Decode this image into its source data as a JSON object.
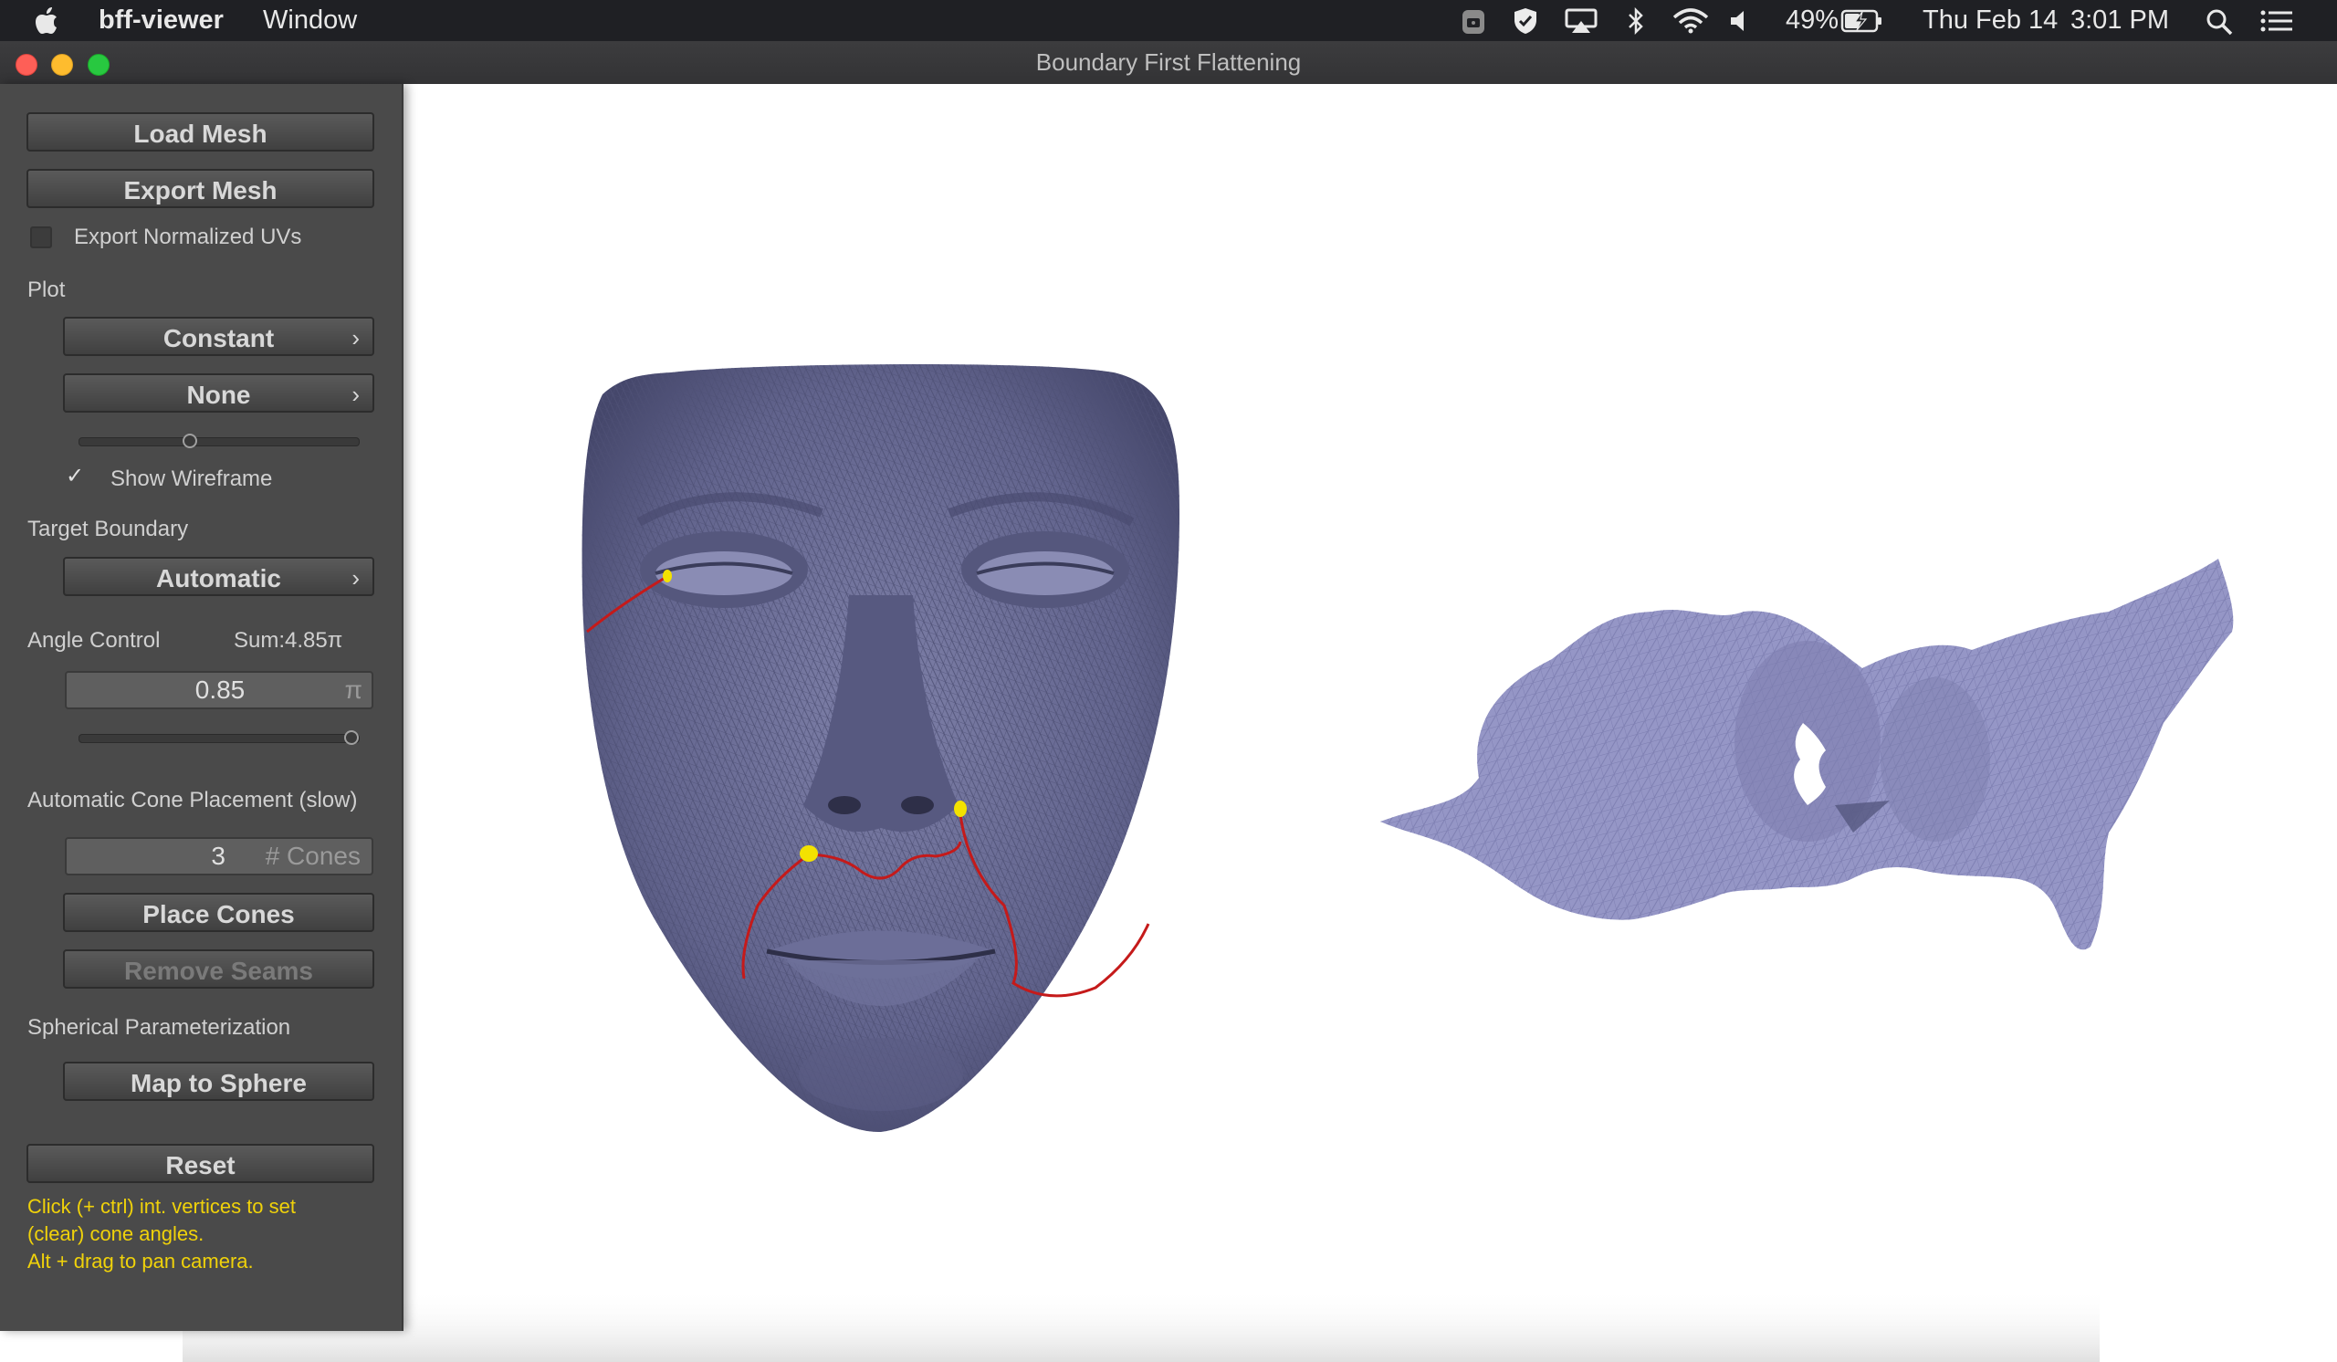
{
  "menubar": {
    "app_name": "bff-viewer",
    "menu_window": "Window",
    "battery_percent": "49%",
    "date": "Thu Feb 14",
    "time": "3:01 PM"
  },
  "window": {
    "title": "Boundary First Flattening"
  },
  "panel": {
    "load_mesh": "Load Mesh",
    "export_mesh": "Export Mesh",
    "export_normalized_uvs": {
      "label": "Export Normalized UVs",
      "checked": false
    },
    "plot": {
      "heading": "Plot",
      "color_mode": "Constant",
      "pattern": "None",
      "pattern_scale_fraction": 0.4
    },
    "show_wireframe": {
      "label": "Show Wireframe",
      "checked": true,
      "check_glyph": "✓"
    },
    "target_boundary": {
      "heading": "Target Boundary",
      "mode": "Automatic"
    },
    "angle_control": {
      "heading": "Angle Control",
      "sum": "Sum:4.85π",
      "value": "0.85",
      "unit": "π",
      "slider_fraction": 0.98
    },
    "cone_placement": {
      "heading": "Automatic Cone Placement (slow)",
      "count": "3",
      "count_placeholder": "# Cones",
      "place_cones": "Place Cones",
      "remove_seams": "Remove Seams"
    },
    "spherical": {
      "heading": "Spherical Parameterization",
      "map_to_sphere": "Map to Sphere"
    },
    "reset": "Reset",
    "hint": {
      "line1": "Click (+ ctrl) int. vertices to set",
      "line2": "(clear) cone angles.",
      "line3": "Alt + drag to pan camera."
    }
  },
  "colors": {
    "mesh": "#6a6c94",
    "flattened_mesh": "#9596c6",
    "seam": "#c51a1a",
    "cone": "#f3e200",
    "hint_text": "#f0d20a"
  },
  "icons": [
    "apple-icon",
    "vpn-icon",
    "shield-icon",
    "airplay-icon",
    "bluetooth-icon",
    "wifi-icon",
    "volume-icon",
    "battery-icon",
    "search-icon",
    "list-icon",
    "chevron-right-icon"
  ]
}
